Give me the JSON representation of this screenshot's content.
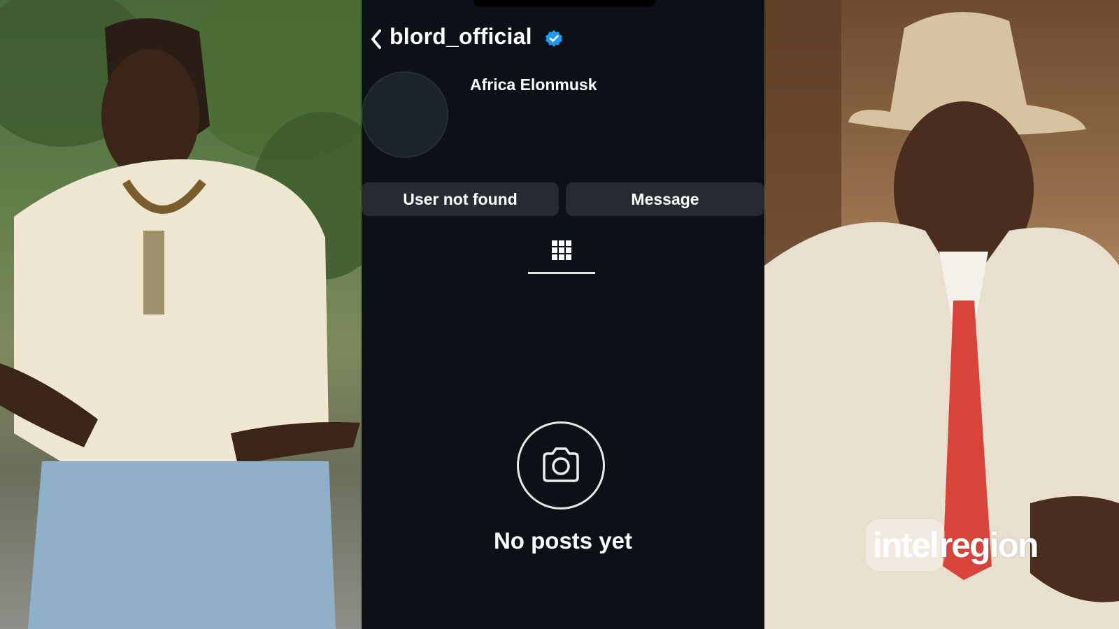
{
  "profile": {
    "username": "blord_official",
    "display_name": "Africa Elonmusk",
    "buttons": {
      "primary": "User not found",
      "secondary": "Message"
    },
    "empty_state": "No posts yet",
    "icons": [
      "back-chevron-icon",
      "verified-badge-icon",
      "grid-icon",
      "camera-icon"
    ]
  },
  "watermark": {
    "part1": "intel",
    "part2": "region"
  },
  "colors": {
    "background": "#0c1118",
    "button": "#262b33",
    "verified": "#1d9bf0",
    "text": "#ffffff"
  }
}
